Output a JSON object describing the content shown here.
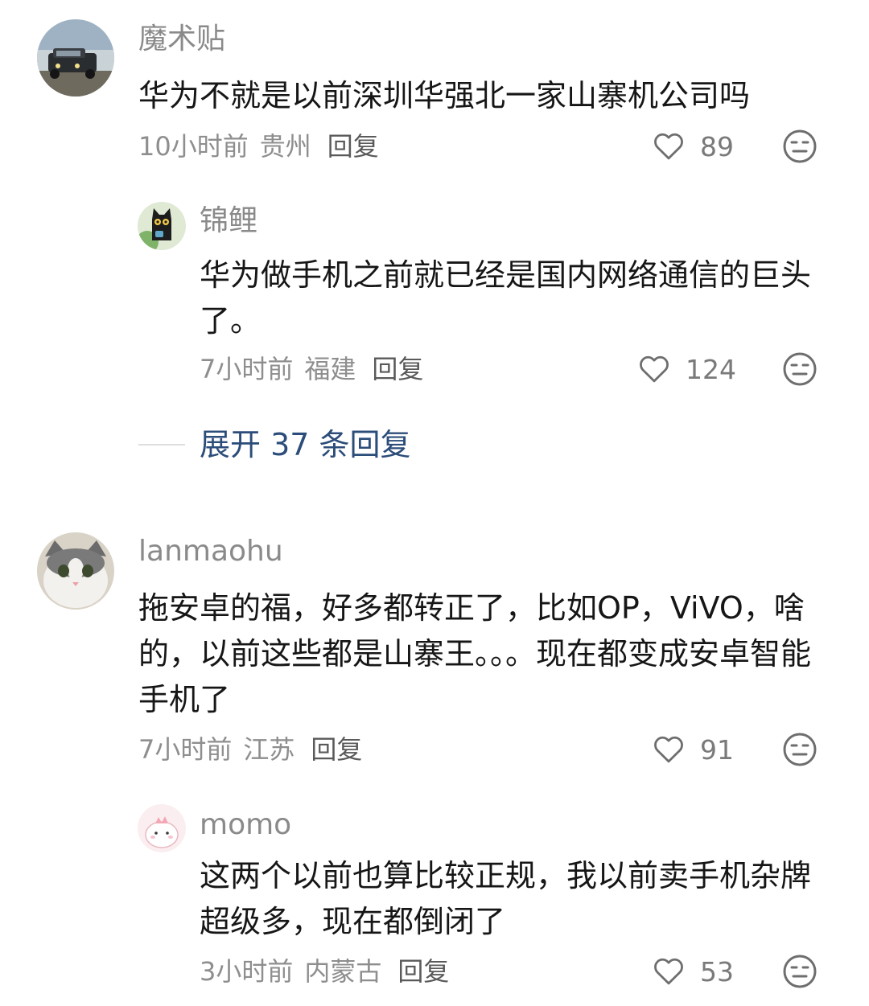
{
  "comments": [
    {
      "user": "魔术贴",
      "avatar": "jeep-photo",
      "text": "华为不就是以前深圳华强北一家山寨机公司吗",
      "time": "10小时前",
      "location": "贵州",
      "reply": "回复",
      "likes": "89"
    },
    {
      "user": "锦鲤",
      "avatar": "black-cat-cartoon",
      "text": "华为做手机之前就已经是国内网络通信的巨头了。",
      "time": "7小时前",
      "location": "福建",
      "reply": "回复",
      "likes": "124"
    },
    {
      "user": "lanmaohu",
      "avatar": "cat-photo",
      "text": "拖安卓的福，好多都转正了，比如OP，ViVO，啥的，以前这些都是山寨王。。。现在都变成安卓智能手机了",
      "time": "7小时前",
      "location": "江苏",
      "reply": "回复",
      "likes": "91"
    },
    {
      "user": "momo",
      "avatar": "pink-dino-cartoon",
      "text": "这两个以前也算比较正规，我以前卖手机杂牌超级多，现在都倒闭了",
      "time": "3小时前",
      "location": "内蒙古",
      "reply": "回复",
      "likes": "53"
    }
  ],
  "expand_label": "展开 37 条回复",
  "icons": {
    "like": "heart-outline-icon",
    "dislike": "meh-face-icon"
  },
  "colors": {
    "expand_link": "#2c4d7a",
    "meta": "#8e8e8e",
    "text": "#161616"
  }
}
